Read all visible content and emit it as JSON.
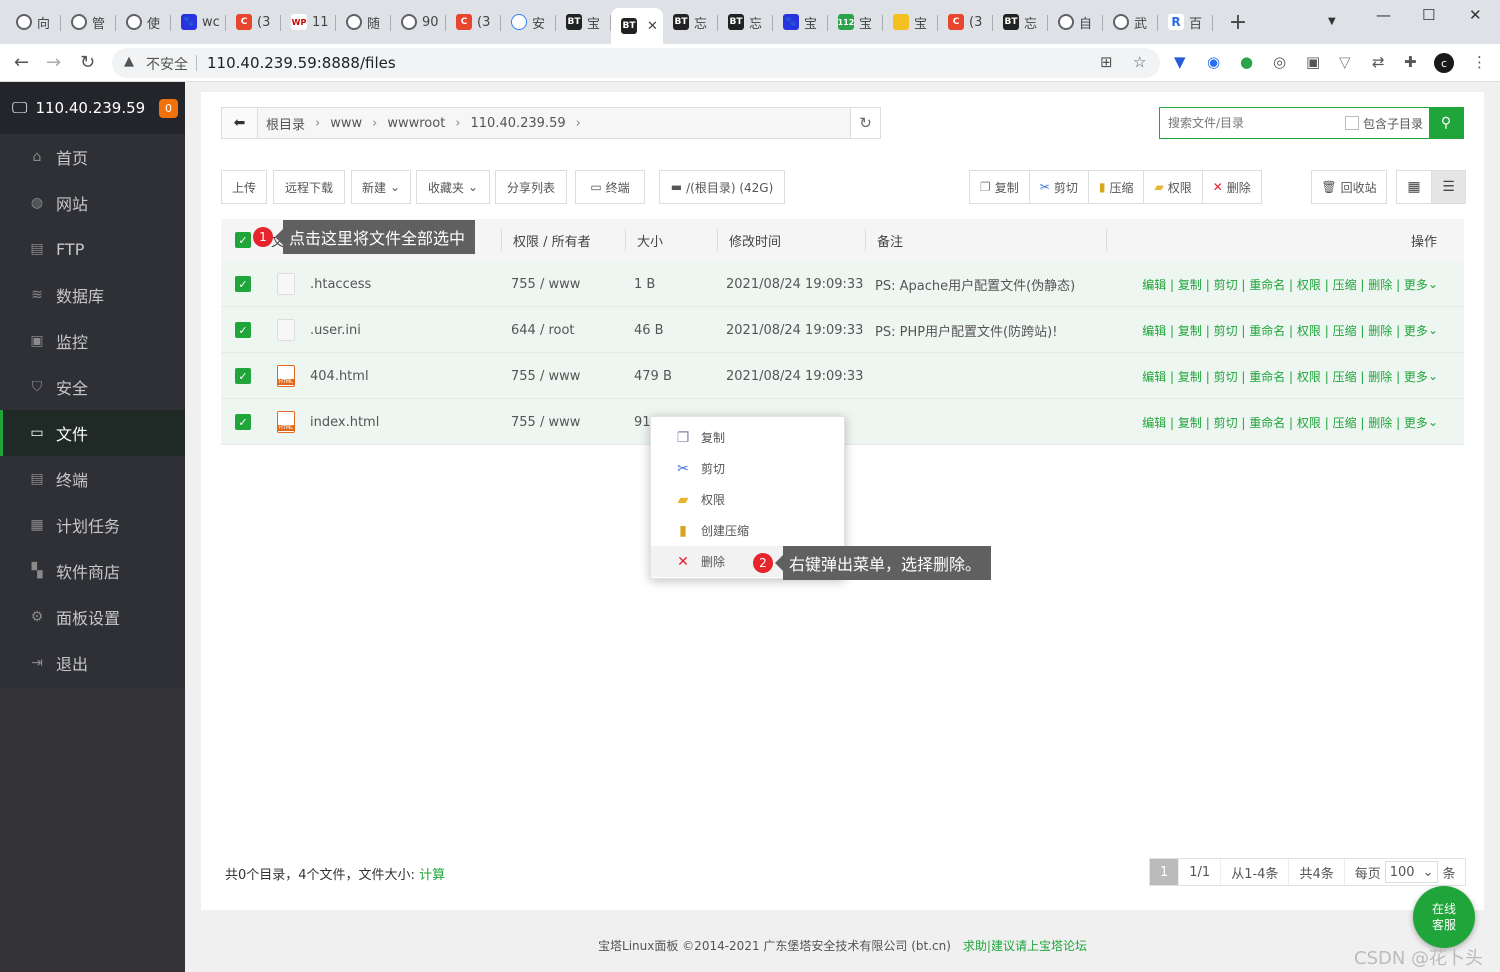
{
  "browser": {
    "tabs": [
      {
        "icon": "globe-icon",
        "label": "向"
      },
      {
        "icon": "globe-icon",
        "label": "管"
      },
      {
        "icon": "globe-icon",
        "label": "使"
      },
      {
        "icon": "baidu-paw-icon",
        "label": "wc"
      },
      {
        "icon": "csdn-c-icon",
        "label": "(3"
      },
      {
        "icon": "wp-icon",
        "label": "11"
      },
      {
        "icon": "feather-icon",
        "label": "随"
      },
      {
        "icon": "globe-icon",
        "label": "90"
      },
      {
        "icon": "csdn-c-icon",
        "label": "(3"
      },
      {
        "icon": "cloud-icon",
        "label": "安"
      },
      {
        "icon": "bt-icon",
        "label": "宝"
      },
      {
        "icon": "bt-icon",
        "label": "",
        "active": true
      },
      {
        "icon": "bt-icon",
        "label": "忘"
      },
      {
        "icon": "bt-icon",
        "label": "忘"
      },
      {
        "icon": "baidu-paw-icon",
        "label": "宝"
      },
      {
        "icon": "n112-icon",
        "label": "宝"
      },
      {
        "icon": "hand-icon",
        "label": "宝"
      },
      {
        "icon": "csdn-c-icon",
        "label": "(3"
      },
      {
        "icon": "bt-icon",
        "label": "忘"
      },
      {
        "icon": "globe-icon",
        "label": "自"
      },
      {
        "icon": "globe-icon",
        "label": "武"
      },
      {
        "icon": "r-icon",
        "label": "百"
      }
    ],
    "insecure_label": "不安全",
    "url": "110.40.239.59:8888/files",
    "avatar_letter": "c"
  },
  "sidebar": {
    "host": "110.40.239.59",
    "badge": "0",
    "items": [
      {
        "label": "首页",
        "icon": "home-icon"
      },
      {
        "label": "网站",
        "icon": "globe-icon"
      },
      {
        "label": "FTP",
        "icon": "ftp-icon"
      },
      {
        "label": "数据库",
        "icon": "database-icon"
      },
      {
        "label": "监控",
        "icon": "monitor-icon"
      },
      {
        "label": "安全",
        "icon": "shield-icon"
      },
      {
        "label": "文件",
        "icon": "folder-icon",
        "active": true
      },
      {
        "label": "终端",
        "icon": "terminal-icon"
      },
      {
        "label": "计划任务",
        "icon": "calendar-icon"
      },
      {
        "label": "软件商店",
        "icon": "apps-icon"
      },
      {
        "label": "面板设置",
        "icon": "gear-icon"
      },
      {
        "label": "退出",
        "icon": "logout-icon"
      }
    ]
  },
  "breadcrumb": [
    "根目录",
    "www",
    "wwwroot",
    "110.40.239.59"
  ],
  "search": {
    "placeholder": "搜索文件/目录",
    "include_sub": "包含子目录"
  },
  "toolbar": {
    "upload": "上传",
    "remote_download": "远程下载",
    "new": "新建",
    "favorites": "收藏夹",
    "share_list": "分享列表",
    "terminal": "终端",
    "disk": "/(根目录) (42G)",
    "copy": "复制",
    "cut": "剪切",
    "compress": "压缩",
    "permission": "权限",
    "delete": "删除",
    "recycle": "回收站"
  },
  "table": {
    "headers": {
      "name": "文件名",
      "perm": "权限 / 所有者",
      "size": "大小",
      "mtime": "修改时间",
      "note": "备注",
      "ops": "操作"
    },
    "ops_labels": "编辑 | 复制 | 剪切 | 重命名 | 权限 | 压缩 | 删除 | 更多",
    "rows": [
      {
        "name": ".htaccess",
        "perm": "755 / www",
        "size": "1 B",
        "mtime": "2021/08/24 19:09:33",
        "note": "PS: Apache用户配置文件(伪静态)",
        "type": "text"
      },
      {
        "name": ".user.ini",
        "perm": "644 / root",
        "size": "46 B",
        "mtime": "2021/08/24 19:09:33",
        "note": "PS: PHP用户配置文件(防跨站)!",
        "type": "text"
      },
      {
        "name": "404.html",
        "perm": "755 / www",
        "size": "479 B",
        "mtime": "2021/08/24 19:09:33",
        "note": "",
        "type": "html"
      },
      {
        "name": "index.html",
        "perm": "755 / www",
        "size": "91",
        "mtime": "3",
        "note": "",
        "type": "html"
      }
    ]
  },
  "annotations": {
    "one": {
      "num": "1",
      "text": "点击这里将文件全部选中"
    },
    "two": {
      "num": "2",
      "text": "右键弹出菜单，选择删除。"
    }
  },
  "context_menu": {
    "items": [
      {
        "label": "复制",
        "icon": "copy-icon"
      },
      {
        "label": "剪切",
        "icon": "scissors-icon"
      },
      {
        "label": "权限",
        "icon": "permission-folder-icon"
      },
      {
        "label": "创建压缩",
        "icon": "zip-icon"
      },
      {
        "label": "删除",
        "icon": "delete-x-icon"
      }
    ]
  },
  "footer": {
    "summary": "共0个目录，4个文件，文件大小: ",
    "calc": "计算",
    "pager": {
      "current": "1",
      "pages": "1/1",
      "range": "从1-4条",
      "total": "共4条",
      "per_page_label": "每页",
      "per_page": "100",
      "unit": "条"
    }
  },
  "copyright": {
    "text": "宝塔Linux面板 ©2014-2021 广东堡塔安全技术有限公司 (bt.cn)",
    "help": "求助|建议请上宝塔论坛"
  },
  "service": {
    "line1": "在线",
    "line2": "客服"
  },
  "watermark": "CSDN @花卜头",
  "colors": {
    "accent": "#20a53a",
    "sidebar": "#2f3036",
    "badge": "#f0700a",
    "annotation": "#e7232c"
  }
}
